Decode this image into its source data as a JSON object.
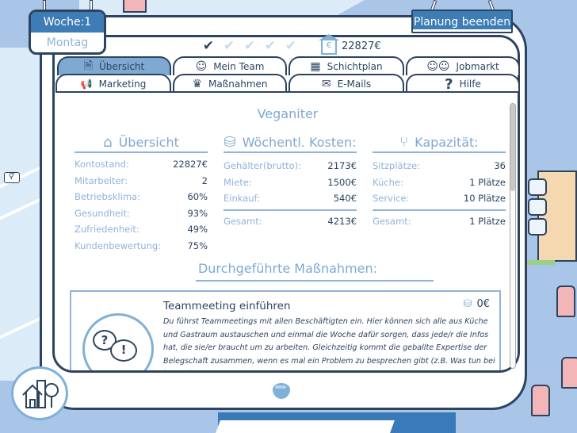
{
  "week": {
    "label": "Woche:1",
    "day": "Montag"
  },
  "end_planning_button": "Planung beenden",
  "progress": {
    "days_total": 5,
    "days_done": 1,
    "check_glyph": "✔"
  },
  "balance": {
    "icon": "house-euro-icon",
    "value": "22827€",
    "euro_glyph": "€"
  },
  "tabs": {
    "row1": [
      {
        "label": "Übersicht",
        "icon": "calculator-document-icon",
        "glyph": "🗎",
        "active": true
      },
      {
        "label": "Mein Team",
        "icon": "waiter-icon",
        "glyph": "☺",
        "active": false
      },
      {
        "label": "Schichtplan",
        "icon": "calendar-icon",
        "glyph": "▦",
        "active": false
      },
      {
        "label": "Jobmarkt",
        "icon": "people-icon",
        "glyph": "☺☺",
        "active": false
      }
    ],
    "row2": [
      {
        "label": "Marketing",
        "icon": "megaphone-icon",
        "glyph": "📢",
        "active": false
      },
      {
        "label": "Maßnahmen",
        "icon": "measures-icon",
        "glyph": "♛",
        "active": false
      },
      {
        "label": "E-Mails",
        "icon": "envelope-icon",
        "glyph": "✉",
        "active": false
      },
      {
        "label": "Hilfe",
        "icon": "question-icon",
        "glyph": "?",
        "active": false
      }
    ]
  },
  "restaurant_name": "Veganiter",
  "overview": {
    "title": "Übersicht",
    "icon_glyph": "⌂",
    "rows": [
      {
        "label": "Kontostand:",
        "value": "22827€"
      },
      {
        "label": "Mitarbeiter:",
        "value": "2"
      },
      {
        "label": "Betriebsklima:",
        "value": "60%"
      },
      {
        "label": "Gesundheit:",
        "value": "93%"
      },
      {
        "label": "Zufriedenheit:",
        "value": "49%"
      },
      {
        "label": "Kundenbewertung:",
        "value": "75%"
      }
    ]
  },
  "weekly_costs": {
    "title": "Wöchentl. Kosten:",
    "icon_glyph": "⛁",
    "rows": [
      {
        "label": "Gehälter(brutto):",
        "value": "2173€"
      },
      {
        "label": "Miete:",
        "value": "1500€"
      },
      {
        "label": "Einkauf:",
        "value": "540€"
      }
    ],
    "total": {
      "label": "Gesamt:",
      "value": "4213€"
    }
  },
  "capacity": {
    "title": "Kapazität:",
    "icon_glyph": "⑂",
    "rows": [
      {
        "label": "Sitzplätze:",
        "value": "36"
      },
      {
        "label": "Küche:",
        "value": "1 Plätze"
      },
      {
        "label": "Service:",
        "value": "10 Plätze"
      }
    ],
    "total": {
      "label": "Gesamt:",
      "value": "1 Plätze"
    }
  },
  "measures": {
    "title": "Durchgeführte Maßnahmen:",
    "items": [
      {
        "title": "Teammeeting einführen",
        "cost": "0€",
        "cost_icon_glyph": "⛁",
        "question_glyph": "?",
        "exclaim_glyph": "!",
        "description": "Du führst Teammeetings mit allen Beschäftigten ein. Hier können sich alle aus Küche und Gastraum austauschen und einmal die Woche dafür sorgen, dass jede/r die Infos hat, die sie/er braucht um zu arbeiten. Gleichzeitig kommt die geballte Expertise der Belegschaft zusammen, wenn es mal ein Problem zu besprechen gibt (z.B. Was tun bei betrunkenen"
      }
    ]
  },
  "scroll": {
    "position_fraction": 0.0,
    "visible_fraction": 0.33
  },
  "colors": {
    "primary_dark": "#2c4460",
    "accent_blue": "#3d7cb5",
    "light_blue": "#7fa9d0",
    "pale_blue": "#8fb3d9",
    "background": "#a9c5e8"
  }
}
